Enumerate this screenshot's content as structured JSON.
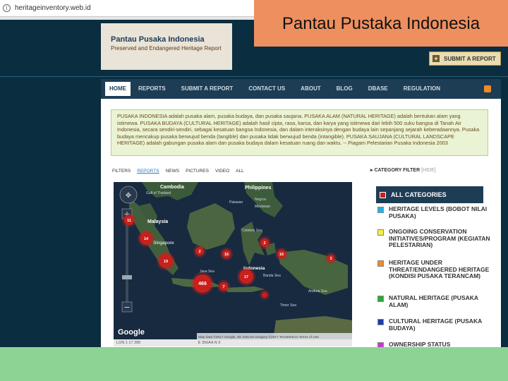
{
  "browser": {
    "url": "heritageinventory.web.id"
  },
  "slide": {
    "title": "Pantau Pustaka Indonesia"
  },
  "site": {
    "logo_title": "Pantau Pusaka Indonesia",
    "logo_subtitle": "Preserved and Endangered Heritage Report",
    "submit_button": "SUBMIT A REPORT"
  },
  "nav": {
    "items": [
      "HOME",
      "REPORTS",
      "SUBMIT A REPORT",
      "CONTACT US",
      "ABOUT",
      "BLOG",
      "DBASE",
      "REGULATION"
    ]
  },
  "intro_text": "PUSAKA INDONESIA adalah pusaka alam, pusaka budaya, dan pusaka saujana. PUSAKA ALAM (NATURAL HERITAGE) adalah bentukan alam yang istimewa. PUSAKA BUDAYA (CULTURAL HERITAGE) adalah hasil cipta, rasa, karsa, dan karya yang istimewa dari lebih 500 suku bangsa di Tanah Air Indonesia, secara sendiri-sendiri, sebagai kesatuan bangsa Indonesia, dan dalam interaksinya dengan budaya lain sepanjang sejarah keberadaannya. Pusaka budaya mencakup pusaka berwujud benda (tangible) dan pusaka tidak berwujud benda (intangible). PUSAKA SAUJANA (CULTURAL LANDSCAPE HERITAGE) adalah gabungan pusaka alam dan pusaka budaya dalam kesatuan ruang dan waktu. -- Piagam Pelestarian Pusaka Indonesia 2003",
  "filters": {
    "label": "FILTERS",
    "items": [
      "REPORTS",
      "NEWS",
      "PICTURES",
      "VIDEO",
      "ALL"
    ],
    "active": "REPORTS"
  },
  "map": {
    "labels": {
      "cambodia": "Cambodia",
      "philippines": "Philippines",
      "malaysia": "Malaysia",
      "singapore": "Singapore",
      "indonesia": "Indonesia",
      "palawan": "Palawan",
      "negros": "Negros",
      "mindanao": "Mindanao",
      "celebes_sea": "Celebes Sea",
      "java_sea": "Java Sea",
      "banda_sea": "Banda Sea",
      "arafura_sea": "Arafura Sea",
      "timor_sea": "Timor Sea",
      "gulf_thailand": "Gulf of Thailand"
    },
    "clusters": [
      {
        "label": "11",
        "color": "#c8201c"
      },
      {
        "label": "14",
        "color": "#c8201c"
      },
      {
        "label": "2",
        "color": "#c8201c"
      },
      {
        "label": "16",
        "color": "#c8201c"
      },
      {
        "label": "2",
        "color": "#c8201c"
      },
      {
        "label": "16",
        "color": "#c8201c"
      },
      {
        "label": "3",
        "color": "#c8201c"
      },
      {
        "label": "19",
        "color": "#c8201c"
      },
      {
        "label": "466",
        "color": "#c8201c"
      },
      {
        "label": "7",
        "color": "#c8201c"
      },
      {
        "label": "17",
        "color": "#c8201c"
      },
      {
        "label": "",
        "color": "#c8201c"
      }
    ],
    "google": "Google",
    "attribution": "Map data ©2017 Google, SK telecom Imagery ©2017 TerraMetrics   Terms of Use",
    "coords": "LON 1 17 285",
    "scale": "E 356AA N 3"
  },
  "categories": {
    "heading": "CATEGORY FILTER",
    "heading_sub": "[HIDE]",
    "all": {
      "label": "ALL CATEGORIES",
      "color": "#c8201c"
    },
    "items": [
      {
        "label": "HERITAGE LEVELS (BOBOT NILAI PUSAKA)",
        "color": "#2ab0e4"
      },
      {
        "label": "ONGOING CONSERVATION INITIATIVES/PROGRAM (KEGIATAN PELESTARIAN)",
        "color": "#f4ee4a"
      },
      {
        "label": "HERITAGE UNDER THREAT/ENDANGERED HERITAGE (KONDISI PUSAKA TERANCAM)",
        "color": "#f08a24"
      },
      {
        "label": "NATURAL HERITAGE (PUSAKA ALAM)",
        "color": "#2aa83a"
      },
      {
        "label": "CULTURAL HERITAGE (PUSAKA BUDAYA)",
        "color": "#1a3fa6"
      },
      {
        "label": "OWNERSHIP STATUS",
        "color": "#c63ad0"
      }
    ]
  },
  "colors": {
    "background": "#0a2d3f",
    "slide_title_bg": "#ee8f5f",
    "nav_bg": "#1d3d55",
    "bottom_band": "#8dd394"
  }
}
